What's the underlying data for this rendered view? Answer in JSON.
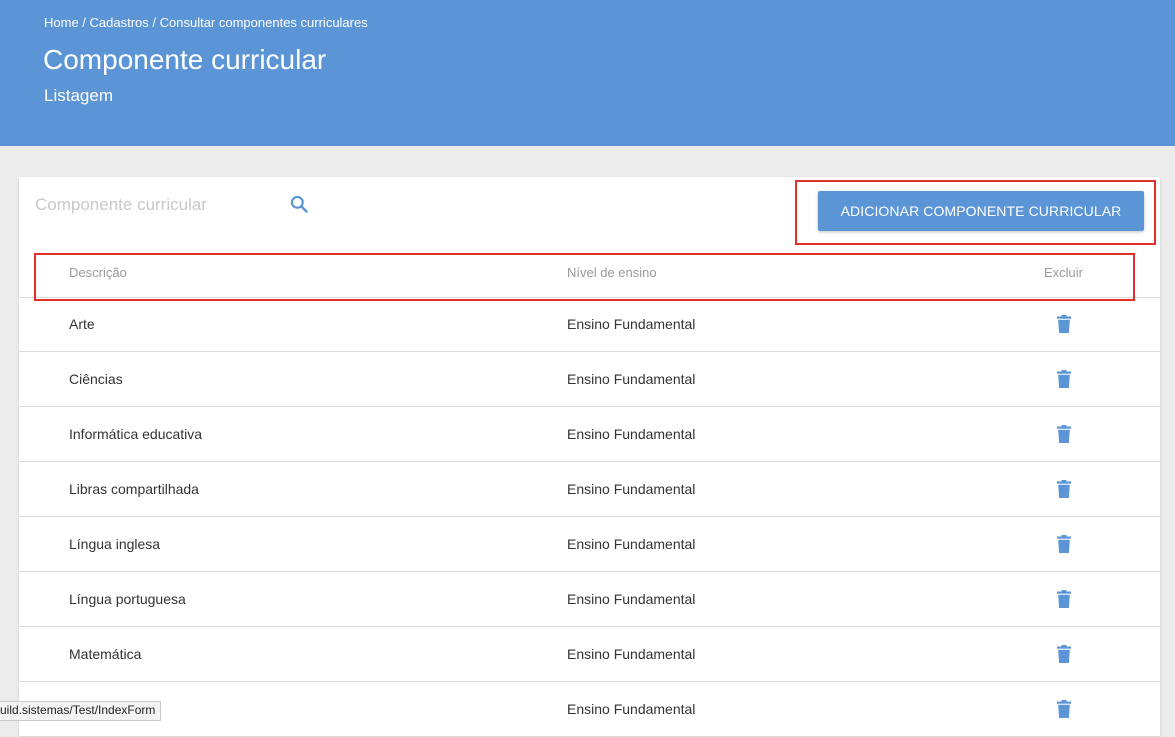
{
  "header": {
    "breadcrumb": [
      {
        "label": "Home"
      },
      {
        "label": "Cadastros"
      },
      {
        "label": "Consultar componentes curriculares"
      }
    ],
    "breadcrumb_separator": " / ",
    "title": "Componente curricular",
    "subtitle": "Listagem"
  },
  "toolbar": {
    "search_placeholder": "Componente curricular",
    "search_value": "",
    "search_icon": "search-icon",
    "add_button_label": "ADICIONAR COMPONENTE CURRICULAR"
  },
  "table": {
    "columns": [
      "Descrição",
      "Nível de ensino",
      "Excluir"
    ],
    "rows": [
      {
        "descricao": "Arte",
        "nivel": "Ensino Fundamental",
        "excluir_icon": "trash-icon"
      },
      {
        "descricao": "Ciências",
        "nivel": "Ensino Fundamental",
        "excluir_icon": "trash-icon"
      },
      {
        "descricao": "Informática educativa",
        "nivel": "Ensino Fundamental",
        "excluir_icon": "trash-icon"
      },
      {
        "descricao": "Libras compartilhada",
        "nivel": "Ensino Fundamental",
        "excluir_icon": "trash-icon"
      },
      {
        "descricao": "Língua inglesa",
        "nivel": "Ensino Fundamental",
        "excluir_icon": "trash-icon"
      },
      {
        "descricao": "Língua portuguesa",
        "nivel": "Ensino Fundamental",
        "excluir_icon": "trash-icon"
      },
      {
        "descricao": "Matemática",
        "nivel": "Ensino Fundamental",
        "excluir_icon": "trash-icon"
      },
      {
        "descricao": "",
        "nivel": "Ensino Fundamental",
        "excluir_icon": "trash-icon"
      }
    ]
  },
  "status_bar": {
    "url": "uild.sistemas/Test/IndexForm"
  },
  "colors": {
    "header_bg": "#5b95d6",
    "accent": "#5b95d6",
    "highlight": "#e0302b",
    "page_bg": "#ececec"
  }
}
